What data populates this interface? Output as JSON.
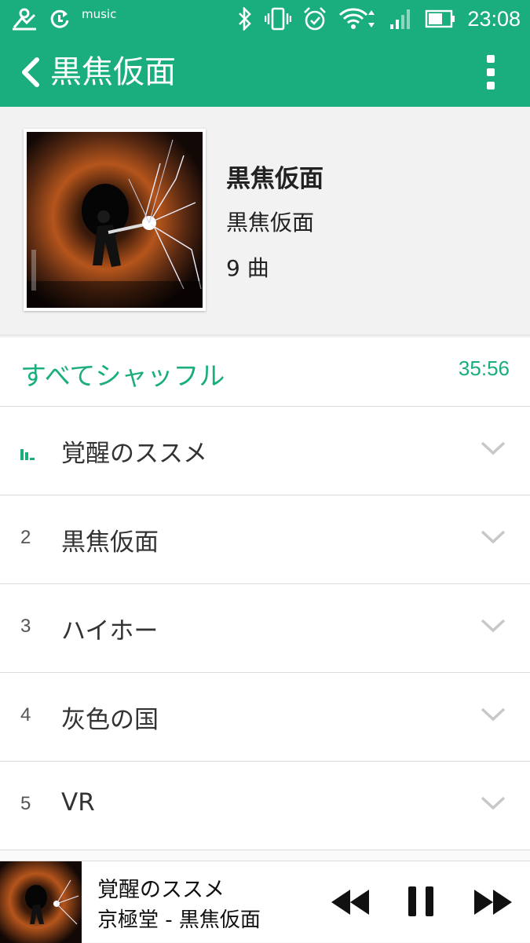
{
  "status_bar": {
    "music_text": "music",
    "time": "23:08",
    "icons": [
      "app-notification-icon",
      "sync-icon",
      "bluetooth-icon",
      "vibrate-icon",
      "alarm-icon",
      "wifi-icon",
      "signal-icon",
      "battery-icon"
    ]
  },
  "app_bar": {
    "title": "黒焦仮面",
    "back_icon": "back-arrow-icon",
    "menu_icon": "overflow-menu-icon"
  },
  "album": {
    "title": "黒焦仮面",
    "artist": "黒焦仮面",
    "track_count": "9 曲"
  },
  "shuffle": {
    "label": "すべてシャッフル",
    "duration": "35:56"
  },
  "tracks": [
    {
      "number": "",
      "title": "覚醒のススメ",
      "playing": true
    },
    {
      "number": "2",
      "title": "黒焦仮面",
      "playing": false
    },
    {
      "number": "3",
      "title": "ハイホー",
      "playing": false
    },
    {
      "number": "4",
      "title": "灰色の国",
      "playing": false
    },
    {
      "number": "5",
      "title": "VR",
      "playing": false
    }
  ],
  "mini_player": {
    "title": "覚醒のススメ",
    "subtitle": "京極堂 - 黒焦仮面"
  },
  "colors": {
    "accent": "#1aad7e",
    "header_bg": "#f2f2f2",
    "divider": "#dcdcdc"
  }
}
